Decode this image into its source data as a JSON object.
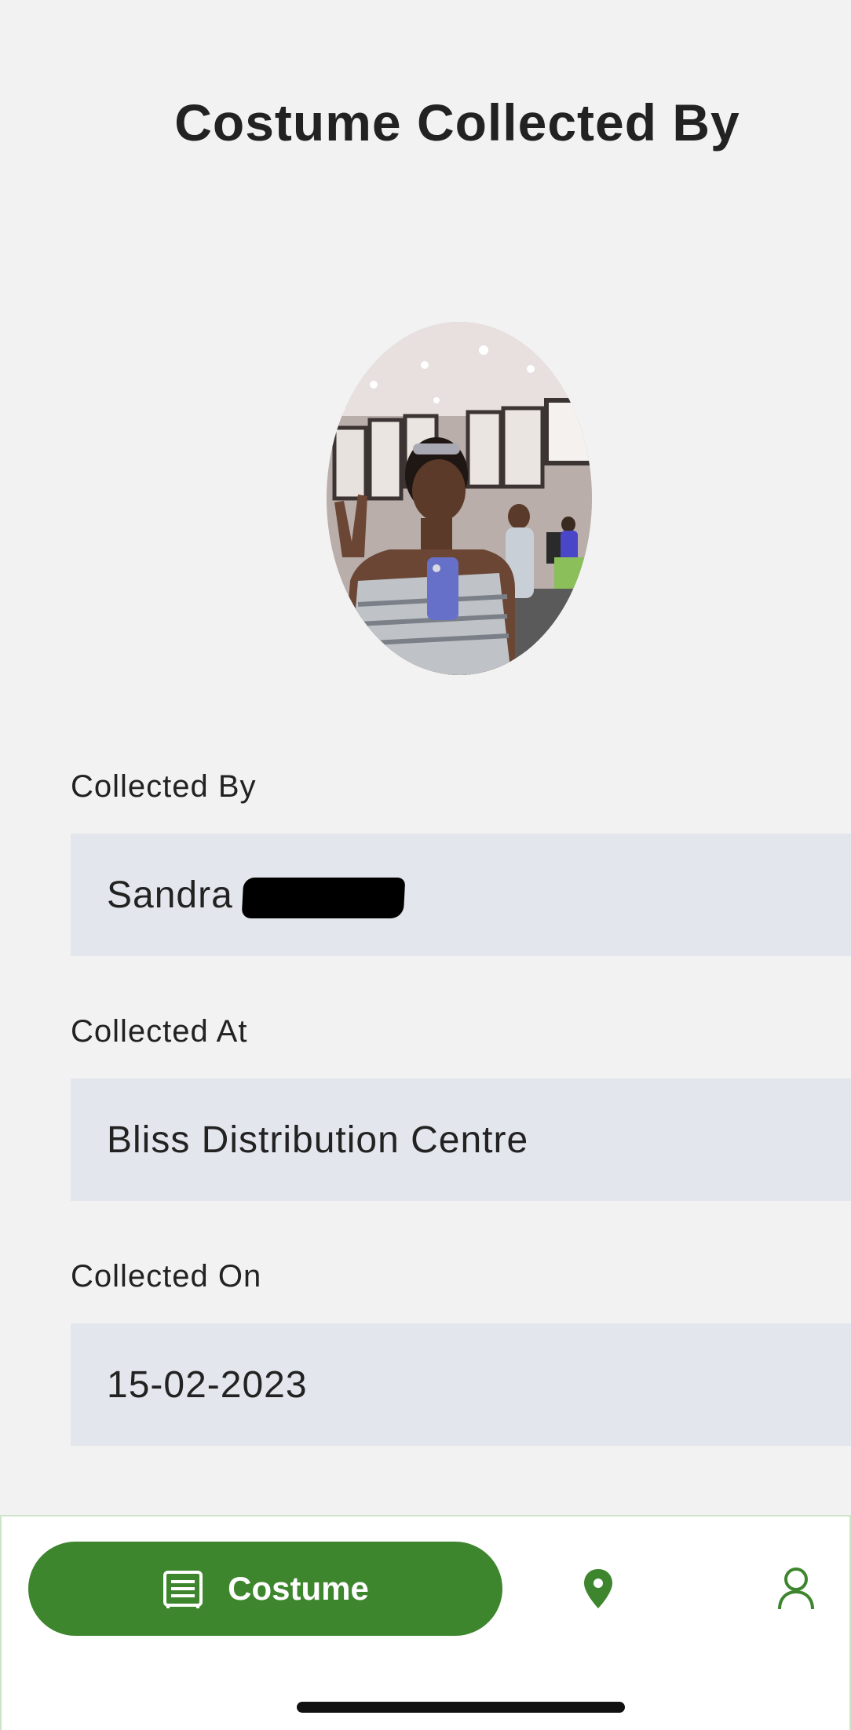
{
  "header": {
    "title": "Costume Collected By"
  },
  "avatar": {
    "description_icon": "profile-photo"
  },
  "fields": {
    "collected_by": {
      "label": "Collected By",
      "value": "Sandra"
    },
    "collected_at": {
      "label": "Collected At",
      "value": "Bliss Distribution Centre"
    },
    "collected_on": {
      "label": "Collected On",
      "value": "15-02-2023"
    }
  },
  "nav": {
    "costume_label": "Costume",
    "costume_icon": "list-doc-icon",
    "location_icon": "location-pin-icon",
    "profile_icon": "person-icon"
  },
  "colors": {
    "accent": "#3e862e",
    "field_bg": "#e3e6ec",
    "page_bg": "#f2f2f2"
  }
}
